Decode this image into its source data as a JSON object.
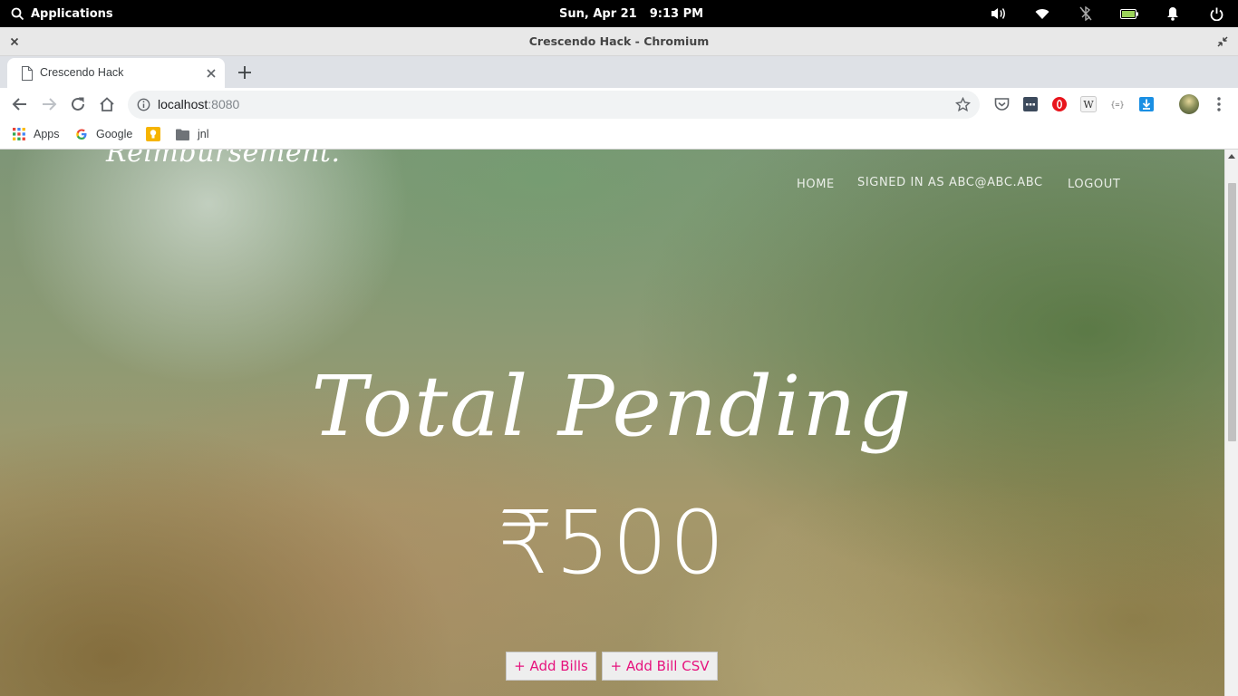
{
  "system_bar": {
    "applications_label": "Applications",
    "date": "Sun, Apr 21",
    "time": "9:13 PM",
    "tray_icons": [
      "volume-icon",
      "wifi-icon",
      "bluetooth-off-icon",
      "battery-icon",
      "notifications-icon",
      "power-icon"
    ]
  },
  "window": {
    "title": "Crescendo Hack - Chromium"
  },
  "browser": {
    "tab_title": "Crescendo Hack",
    "url_host": "localhost",
    "url_port": ":8080",
    "bookmarks": [
      {
        "label": "Apps",
        "icon": "apps-grid-icon"
      },
      {
        "label": "Google",
        "icon": "google-icon"
      },
      {
        "label": "",
        "icon": "keep-bulb-icon"
      },
      {
        "label": "jnl",
        "icon": "folder-icon"
      }
    ],
    "extensions": [
      "pocket-icon",
      "extension-dark-icon",
      "opera-vpn-icon",
      "wikipedia-icon",
      "json-viewer-icon",
      "download-icon"
    ]
  },
  "page": {
    "brand": "Reimbursement.",
    "nav": {
      "home": "HOME",
      "signed_in": "SIGNED IN AS ABC@ABC.ABC",
      "logout": "LOGOUT"
    },
    "hero_title": "Total Pending",
    "amount": "₹500",
    "buttons": {
      "add_bills": "+ Add Bills",
      "add_bill_csv": "+ Add Bill CSV"
    }
  },
  "colors": {
    "button_text": "#e6137d",
    "top_bar": "#000000",
    "tab_strip": "#dee1e6"
  }
}
